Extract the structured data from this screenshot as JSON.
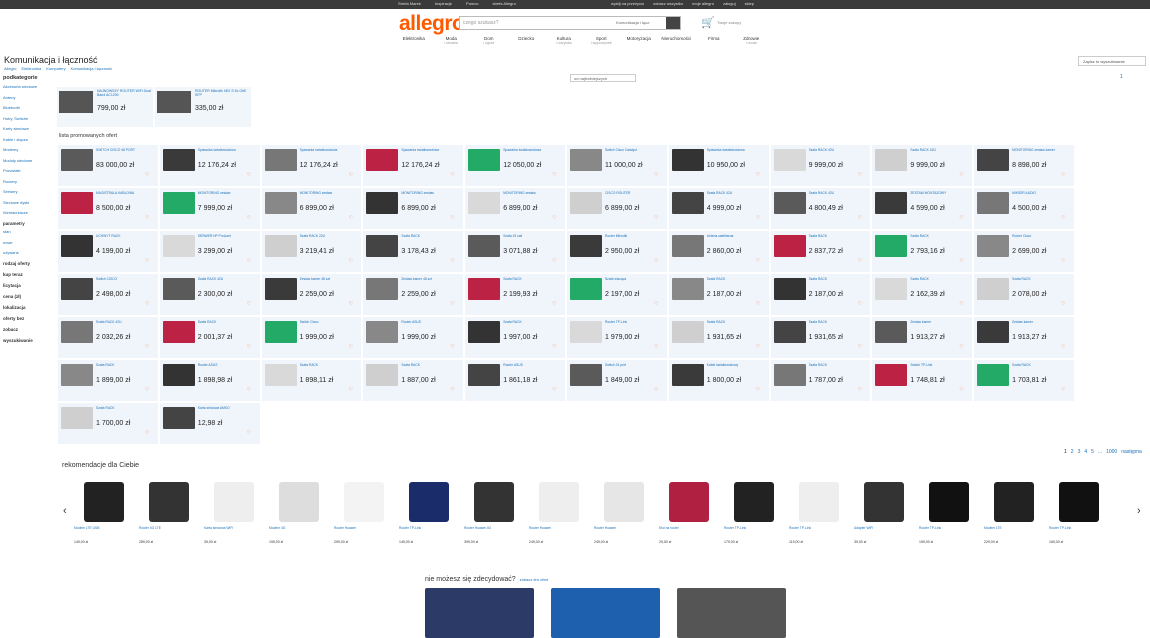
{
  "topbar": {
    "links": [
      "Strefa Marek",
      "Inspiracje",
      "Pomoc",
      "strefa Allegro"
    ],
    "links2": [
      "wyślij na przeżyciu",
      "zobacz wszystko",
      "moje allegro",
      "zaloguj",
      "sklep"
    ]
  },
  "header": {
    "logo": "allegro",
    "search_placeholder": "czego szukasz?",
    "search_category": "Komunikacja i łącz.",
    "cart_label": "Twoje zakupy"
  },
  "categories": [
    {
      "label": "Elektronika",
      "sub": ""
    },
    {
      "label": "Moda",
      "sub": "i ubrania"
    },
    {
      "label": "Dom",
      "sub": "i ogród"
    },
    {
      "label": "Dziecko",
      "sub": ""
    },
    {
      "label": "Kultura",
      "sub": "i rozrywka"
    },
    {
      "label": "Sport",
      "sub": "i wypoczynek"
    },
    {
      "label": "Motoryzacja",
      "sub": ""
    },
    {
      "label": "Nieruchomości",
      "sub": ""
    },
    {
      "label": "Firma",
      "sub": ""
    },
    {
      "label": "Zdrowie",
      "sub": "i uroda"
    }
  ],
  "page": {
    "title": "Komunikacja i łączność",
    "breadcrumb": [
      "Allegro",
      "Elektronika",
      "Komputery",
      "Komunikacja i łączność"
    ],
    "top_right": "Zapisz to wyszukiwanie",
    "sort": "od najtrafniejszych",
    "pager_top": "1"
  },
  "sidebar": {
    "header": "podkategorie",
    "items": [
      "Akcesoria sieciowe",
      "Anteny",
      "Bluetooth",
      "Huby, Switche",
      "Karty sieciowe",
      "Kable i złącza",
      "Modemy",
      "Moduły sieciowe",
      "Pozostałe",
      "Routery",
      "Serwery",
      "Sieciowe dyski",
      "Wzmacniacze"
    ],
    "params_header": "parametry",
    "params": [
      "stan",
      "nowe",
      "używane"
    ],
    "sections": [
      "rodzaj oferty",
      "kup teraz",
      "licytacja",
      "cena (zł)",
      "lokalizacja",
      "oferty bez",
      "zobacz",
      "wyszukiwanie"
    ]
  },
  "featured": [
    {
      "title": "NAJNOWSZY ROUTER WiFi Dual Band AC1200",
      "price": "799,00 zł"
    },
    {
      "title": "ROUTER Mikrotik hEX S 5x GbE SFP",
      "price": "335,00 zł"
    }
  ],
  "promoted_label": "lista promowanych ofert",
  "grid_rows": [
    [
      [
        "SWITCH CISCO 48 PORT",
        "83 000,00 zł"
      ],
      [
        "Spawarka światłowodowa",
        "12 176,24 zł"
      ],
      [
        "Spawarka światłowodowa",
        "12 176,24 zł"
      ],
      [
        "Spawarka światłowodowa",
        "12 176,24 zł"
      ],
      [
        "Spawarka światłowodowa",
        "12 050,00 zł"
      ],
      [
        "Switch Cisco Catalyst",
        "11 000,00 zł"
      ],
      [
        "Spawarka światłowodowa",
        "10 950,00 zł"
      ],
      [
        "Szafa RACK 42U",
        "9 999,00 zł"
      ],
      [
        "Szafa RACK 42U",
        "9 999,00 zł"
      ],
      [
        "MONITORING zestaw kamer",
        "8 898,00 zł"
      ]
    ],
    [
      [
        "MAGISTRALA KABLOWA",
        "8 500,00 zł"
      ],
      [
        "MONITORING zestaw",
        "7 999,00 zł"
      ],
      [
        "MONITORING zestaw",
        "6 899,00 zł"
      ],
      [
        "MONITORING zestaw",
        "6 899,00 zł"
      ],
      [
        "MONITORING zestaw",
        "6 899,00 zł"
      ],
      [
        "CISCO ROUTER",
        "6 899,00 zł"
      ],
      [
        "Szafa RACK 42U",
        "4 999,00 zł"
      ],
      [
        "Szafa RACK 42U",
        "4 800,49 zł"
      ],
      [
        "ZESTAW MONTAŻOWY",
        "4 599,00 zł"
      ],
      [
        "MIKSER AUDIO",
        "4 500,00 zł"
      ]
    ],
    [
      [
        "UCHWYT RACK",
        "4 199,00 zł"
      ],
      [
        "SERWER HP ProLiant",
        "3 299,00 zł"
      ],
      [
        "Szafa RACK 22U",
        "3 219,41 zł"
      ],
      [
        "Szafa RACK",
        "3 178,43 zł"
      ],
      [
        "Szafa 19 cali",
        "3 071,88 zł"
      ],
      [
        "Router Mikrotik",
        "2 950,00 zł"
      ],
      [
        "Antena satelitarna",
        "2 860,00 zł"
      ],
      [
        "Szafa RACK",
        "2 837,72 zł"
      ],
      [
        "Szafa RACK",
        "2 793,16 zł"
      ],
      [
        "Router Cisco",
        "2 699,00 zł"
      ]
    ],
    [
      [
        "Switch CISCO",
        "2 498,00 zł"
      ],
      [
        "Szafa RACK 42U",
        "2 300,00 zł"
      ],
      [
        "Zestaw kamer 48 szt",
        "2 259,00 zł"
      ],
      [
        "Zestaw kamer 48 szt",
        "2 259,00 zł"
      ],
      [
        "Szafa RACK",
        "2 199,93 zł"
      ],
      [
        "Szafa wisząca",
        "2 197,00 zł"
      ],
      [
        "Szafa RACK",
        "2 187,00 zł"
      ],
      [
        "Szafa RACK",
        "2 187,00 zł"
      ],
      [
        "Szafa RACK",
        "2 162,39 zł"
      ],
      [
        "Szafa RACK",
        "2 078,00 zł"
      ]
    ],
    [
      [
        "Szafa RACK 42U",
        "2 032,26 zł"
      ],
      [
        "Szafa RACK",
        "2 001,37 zł"
      ],
      [
        "Switch Cisco",
        "1 999,00 zł"
      ],
      [
        "Router ASUS",
        "1 999,00 zł"
      ],
      [
        "Szafa RACK",
        "1 997,00 zł"
      ],
      [
        "Router TP-Link",
        "1 979,00 zł"
      ],
      [
        "Szafa RACK",
        "1 931,65 zł"
      ],
      [
        "Szafa RACK",
        "1 931,65 zł"
      ],
      [
        "Zestaw kamer",
        "1 913,27 zł"
      ],
      [
        "Zestaw kamer",
        "1 913,27 zł"
      ]
    ],
    [
      [
        "Szafa RACK",
        "1 899,00 zł"
      ],
      [
        "Router ASUS",
        "1 898,98 zł"
      ],
      [
        "Szafa RACK",
        "1 898,11 zł"
      ],
      [
        "Szafa RACK",
        "1 887,00 zł"
      ],
      [
        "Router ASUS",
        "1 861,18 zł"
      ],
      [
        "Switch 24 port",
        "1 849,00 zł"
      ],
      [
        "Kabel światłowodowy",
        "1 800,00 zł"
      ],
      [
        "Szafa RACK",
        "1 787,00 zł"
      ],
      [
        "Switch TP-Link",
        "1 748,81 zł"
      ],
      [
        "Szafa RACK",
        "1 703,81 zł"
      ]
    ],
    [
      [
        "Szafa RACK",
        "1 700,00 zł"
      ],
      [
        "Karta sieciowa AMSO",
        "12,98 zł"
      ]
    ]
  ],
  "pager": {
    "pages": [
      "1",
      "2",
      "3",
      "4",
      "5",
      "...",
      "1000"
    ],
    "next": "następna"
  },
  "recommend_label": "rekomendacje dla Ciebie",
  "recommendations": [
    [
      "Modem LTE USB",
      "149,00 zł"
    ],
    [
      "Router 4G LTE",
      "289,00 zł"
    ],
    [
      "Karta sieciowa WiFi",
      "39,00 zł"
    ],
    [
      "Modem 4G",
      "199,00 zł"
    ],
    [
      "Router Huawei",
      "299,00 zł"
    ],
    [
      "Router TP-Link",
      "149,00 zł"
    ],
    [
      "Router Huawei 4G",
      "399,00 zł"
    ],
    [
      "Router Huawei",
      "249,00 zł"
    ],
    [
      "Router Huawei",
      "249,00 zł"
    ],
    [
      "Etui na router",
      "29,00 zł"
    ],
    [
      "Router TP-Link",
      "179,00 zł"
    ],
    [
      "Router TP-Link",
      "119,00 zł"
    ],
    [
      "Adapter WiFi",
      "39,00 zł"
    ],
    [
      "Router TP-Link",
      "199,00 zł"
    ],
    [
      "Modem LTE",
      "229,00 zł"
    ],
    [
      "Router TP-Link",
      "169,00 zł"
    ]
  ],
  "unsure": {
    "title": "nie możesz się zdecydować?",
    "sub": "zobacz ten ofert"
  }
}
